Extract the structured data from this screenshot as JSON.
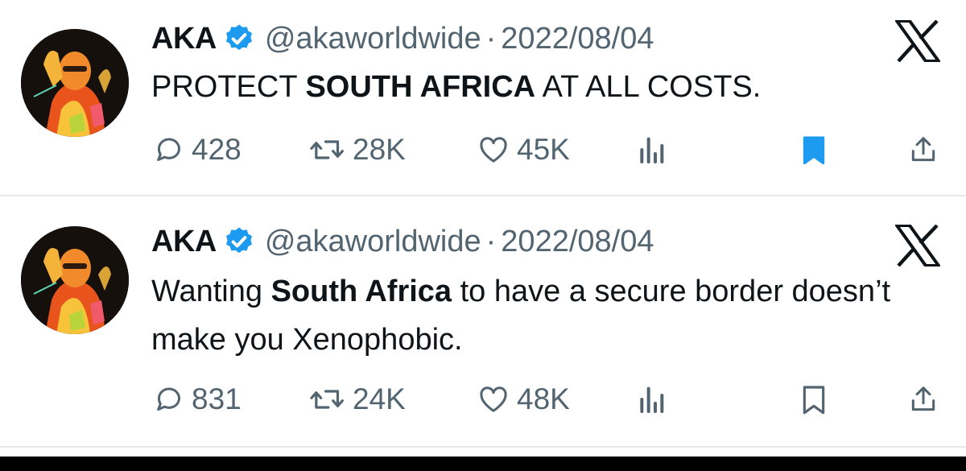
{
  "tweets": [
    {
      "author_name": "AKA",
      "handle": "@akaworldwide",
      "separator": "·",
      "date": "2022/08/04",
      "text_parts": [
        {
          "text": "PROTECT ",
          "bold": false
        },
        {
          "text": "SOUTH AFRICA",
          "bold": true
        },
        {
          "text": " AT ALL COSTS.",
          "bold": false
        }
      ],
      "stats": {
        "replies": "428",
        "retweets": "28K",
        "likes": "45K"
      },
      "bookmarked": true
    },
    {
      "author_name": "AKA",
      "handle": "@akaworldwide",
      "separator": "·",
      "date": "2022/08/04",
      "text_parts": [
        {
          "text": "Wanting ",
          "bold": false
        },
        {
          "text": "South Africa",
          "bold": true
        },
        {
          "text": " to have a secure border doesn’t make you Xenophobic.",
          "bold": false
        }
      ],
      "stats": {
        "replies": "831",
        "retweets": "24K",
        "likes": "48K"
      },
      "bookmarked": false
    }
  ],
  "icons": {
    "verified": "verified-badge-icon",
    "x_logo": "x-logo-icon",
    "reply": "reply-icon",
    "retweet": "retweet-icon",
    "like": "heart-icon",
    "views": "views-icon",
    "bookmark": "bookmark-icon",
    "share": "share-icon"
  },
  "colors": {
    "accent": "#1d9bf0",
    "text": "#0f1419",
    "muted": "#536471",
    "divider": "#e7e7e7"
  }
}
